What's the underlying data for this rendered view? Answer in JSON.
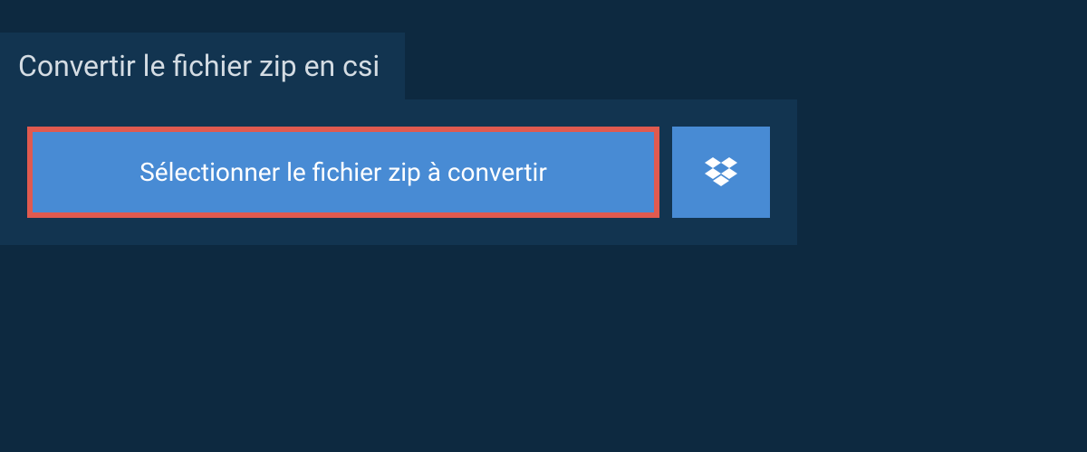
{
  "header": {
    "title": "Convertir le fichier zip en csi"
  },
  "actions": {
    "select_label": "Sélectionner le fichier zip à convertir"
  },
  "colors": {
    "page_bg": "#0d2940",
    "panel_bg": "#123450",
    "button_bg": "#488bd4",
    "highlight_border": "#e05a4f",
    "text_light": "#d4dce3",
    "text_white": "#ffffff"
  }
}
